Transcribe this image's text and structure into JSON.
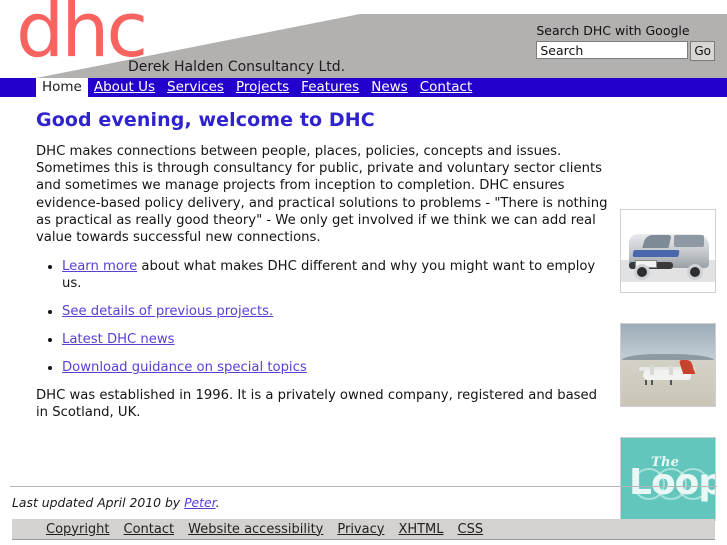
{
  "site": {
    "logo_text": "dhc",
    "tagline": "Derek Halden Consultancy Ltd."
  },
  "search": {
    "label": "Search DHC with Google",
    "value": "Search",
    "placeholder": "Search",
    "button_label": "Go"
  },
  "nav": {
    "items": [
      {
        "label": "Home",
        "active": true
      },
      {
        "label": "About Us",
        "active": false
      },
      {
        "label": "Services",
        "active": false
      },
      {
        "label": "Projects",
        "active": false
      },
      {
        "label": "Features",
        "active": false
      },
      {
        "label": "News",
        "active": false
      },
      {
        "label": "Contact",
        "active": false
      }
    ]
  },
  "main": {
    "title": "Good evening, welcome to DHC",
    "intro": "DHC makes connections between people, places, policies, concepts and issues. Sometimes this is through consultancy for public, private and voluntary sector clients and sometimes we manage projects from inception to completion. DHC ensures evidence-based policy delivery, and practical solutions to problems - \"There is nothing as practical as really good theory\" - We only get involved if we think we can add real value towards successful new connections.",
    "links": [
      {
        "link_text": "Learn more",
        "rest_text": " about what makes DHC different and why you might want to employ us."
      },
      {
        "link_text": "See details of previous projects.",
        "rest_text": ""
      },
      {
        "link_text": "Latest DHC news",
        "rest_text": ""
      },
      {
        "link_text": "Download guidance on special topics",
        "rest_text": ""
      }
    ],
    "outro": "DHC was established in 1996. It is a privately owned company, registered and based in Scotland, UK."
  },
  "side_images": [
    {
      "name": "van-photo",
      "caption": "Silver DHC branded van"
    },
    {
      "name": "plane-photo",
      "caption": "Small propeller aircraft on a beach runway"
    },
    {
      "name": "loop-logo",
      "caption": "The Loop",
      "title_small": "The",
      "title_large": "Loop"
    }
  ],
  "footer": {
    "last_updated_prefix": "Last updated April 2010 by ",
    "last_updated_author": "Peter",
    "last_updated_suffix": ".",
    "links": [
      {
        "label": "Copyright"
      },
      {
        "label": "Contact"
      },
      {
        "label": "Website accessibility"
      },
      {
        "label": "Privacy"
      },
      {
        "label": "XHTML"
      },
      {
        "label": "CSS"
      }
    ]
  },
  "colors": {
    "nav_blue": "#2500cc",
    "logo_red": "#f9635f",
    "header_grey": "#b3b0b0",
    "heading_blue": "#2f22cf",
    "link_purple": "#5a3fd6",
    "footer_grey": "#d4d2d0",
    "loop_teal": "#62c6bd"
  }
}
